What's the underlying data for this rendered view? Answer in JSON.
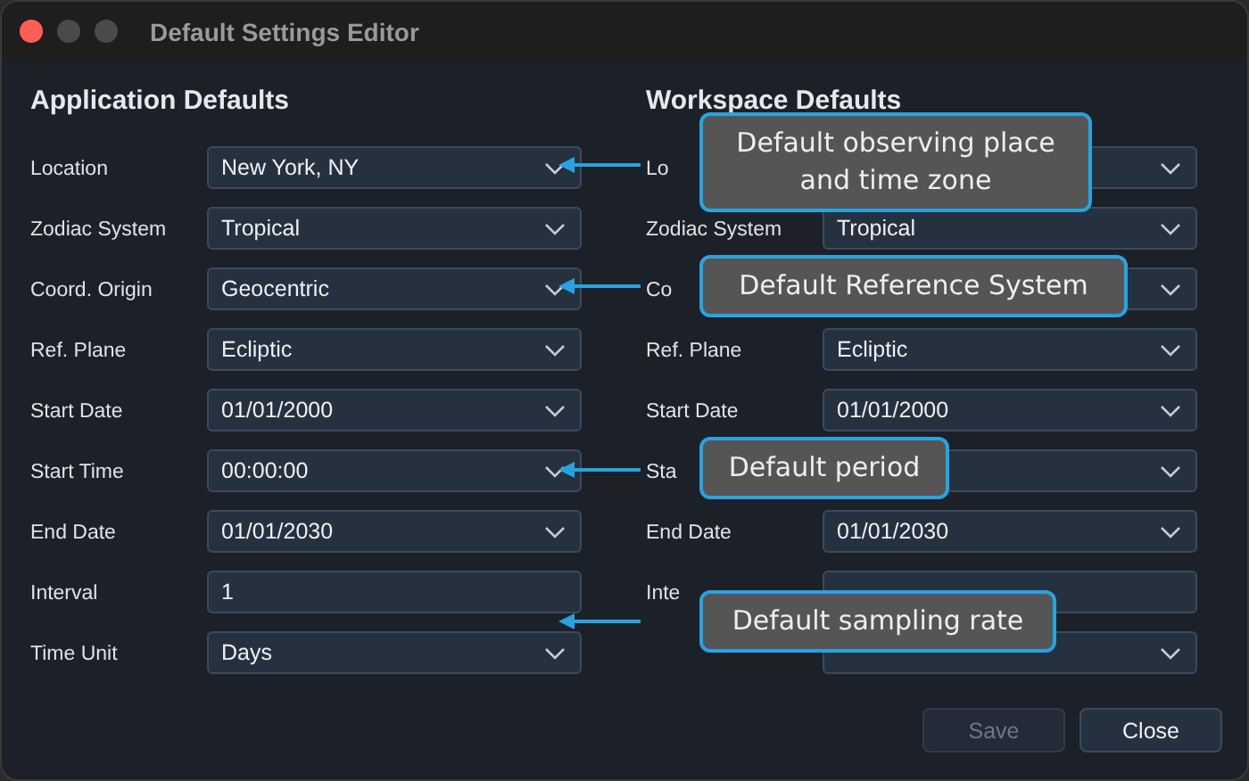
{
  "window": {
    "title": "Default Settings Editor"
  },
  "sections": [
    {
      "title": "Application Defaults",
      "fields": [
        {
          "label": "Location",
          "value": "New York, NY",
          "kind": "select"
        },
        {
          "label": "Zodiac System",
          "value": "Tropical",
          "kind": "select"
        },
        {
          "label": "Coord. Origin",
          "value": "Geocentric",
          "kind": "select"
        },
        {
          "label": "Ref. Plane",
          "value": "Ecliptic",
          "kind": "select"
        },
        {
          "label": "Start Date",
          "value": "01/01/2000",
          "kind": "select"
        },
        {
          "label": "Start Time",
          "value": "00:00:00",
          "kind": "select"
        },
        {
          "label": "End Date",
          "value": "01/01/2030",
          "kind": "select"
        },
        {
          "label": "Interval",
          "value": "1",
          "kind": "input"
        },
        {
          "label": "Time Unit",
          "value": "Days",
          "kind": "select"
        }
      ]
    },
    {
      "title": "Workspace Defaults",
      "fields": [
        {
          "label": "Lo",
          "kind": "select"
        },
        {
          "label": "Zodiac System",
          "value": "Tropical",
          "kind": "select"
        },
        {
          "label": "Co",
          "kind": "select"
        },
        {
          "label": "Ref. Plane",
          "value": "Ecliptic",
          "kind": "select"
        },
        {
          "label": "Start Date",
          "value": "01/01/2000",
          "kind": "select"
        },
        {
          "label": "Sta",
          "kind": "select"
        },
        {
          "label": "End Date",
          "value": "01/01/2030",
          "kind": "select"
        },
        {
          "label": "Inte",
          "kind": "input"
        },
        {
          "kind": "select"
        }
      ]
    }
  ],
  "buttons": [
    {
      "label": "Save",
      "disabled": true
    },
    {
      "label": "Close",
      "disabled": false
    }
  ],
  "callouts": [
    {
      "text": "Default observing place and time zone"
    },
    {
      "text": "Default Reference System"
    },
    {
      "text": "Default period"
    },
    {
      "text": "Default sampling rate"
    }
  ]
}
